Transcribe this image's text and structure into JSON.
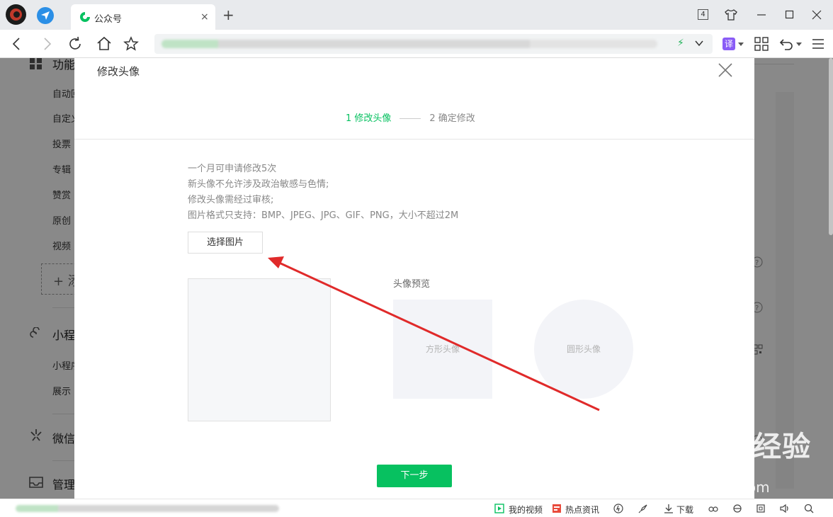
{
  "browser": {
    "tab_title": "公众号",
    "tab_close": "×",
    "new_tab": "+",
    "tab_count": "4",
    "translate_label": "译"
  },
  "sidebar": {
    "section1_title": "功能",
    "section1_items": [
      "自动回",
      "自定义",
      "投票",
      "专辑",
      "赞赏",
      "原创",
      "视频"
    ],
    "add_label": "+ 添",
    "section2_title": "小程",
    "section2_items": [
      "小程序",
      "展示"
    ],
    "section3_title": "微信",
    "section4_title": "管理"
  },
  "dialog": {
    "title": "修改头像",
    "step1": "1 修改头像",
    "step2": "2 确定修改",
    "tips": [
      "一个月可申请修改5次",
      "新头像不允许涉及政治敏感与色情;",
      "修改头像需经过审核;",
      "图片格式只支持：BMP、JPEG、JPG、GIF、PNG，大小不超过2M"
    ],
    "choose_button": "选择图片",
    "preview_label": "头像预览",
    "square_preview": "方形头像",
    "circle_preview": "圆形头像",
    "next_button": "下一步"
  },
  "watermark": {
    "logo_text": "Bai du 经验",
    "domain": "jingyan.baidu.com"
  },
  "statusbar": {
    "my_video": "我的视频",
    "hot_news": "热点资讯",
    "download": "下载"
  },
  "colors": {
    "accent": "#07c160",
    "arrow": "#e02a2a"
  }
}
